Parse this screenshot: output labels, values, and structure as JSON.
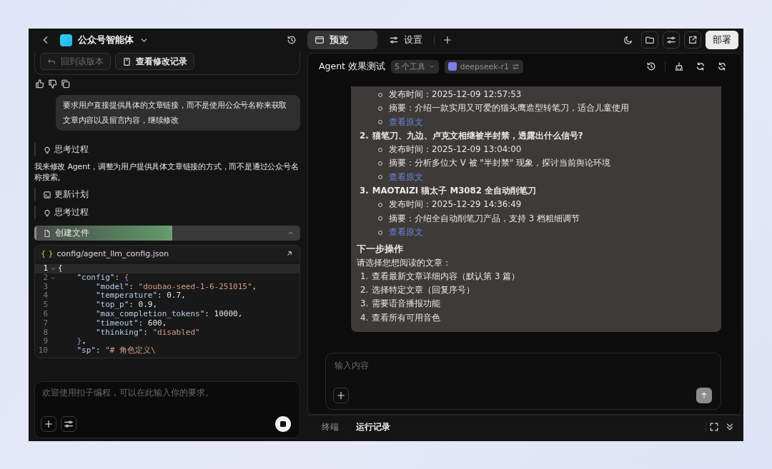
{
  "app_bar": {
    "title": "公众号智能体"
  },
  "tabs": [
    {
      "label": "预览",
      "selected": true
    },
    {
      "label": "设置",
      "selected": false
    }
  ],
  "deploy_button": "部署",
  "chat": {
    "version_buttons": [
      {
        "label": "回到该版本",
        "disabled": true
      },
      {
        "label": "查看修改记录",
        "disabled": false
      }
    ],
    "user_message": "要求用户直接提供具体的文章链接，而不是使用公众号名称来获取文章内容以及留言内容，继续修改",
    "steps": [
      {
        "kind": "thinking",
        "label": "思考过程"
      },
      {
        "kind": "text",
        "text": "我来修改 Agent，调整为用户提供具体文章链接的方式，而不是通过公众号名称搜索。"
      },
      {
        "kind": "plan",
        "label": "更新计划"
      },
      {
        "kind": "thinking",
        "label": "思考过程"
      },
      {
        "kind": "file",
        "label": "创建文件",
        "level": 0.52,
        "expanded": true
      }
    ],
    "file": {
      "glyph": "{ }",
      "path": "config/agent_llm_config.json",
      "lines": [
        {
          "number": "1",
          "foldable": true,
          "current": true,
          "tokens": [
            {
              "text": "{",
              "kind": "punct"
            }
          ]
        },
        {
          "number": "2",
          "foldable": true,
          "current": false,
          "tokens": [
            {
              "text": "    \"config\"",
              "kind": "key"
            },
            {
              "text": ": ",
              "kind": "punct"
            },
            {
              "text": "{",
              "kind": "brace"
            }
          ]
        },
        {
          "number": "3",
          "foldable": false,
          "current": false,
          "tokens": [
            {
              "text": "        \"model\"",
              "kind": "key"
            },
            {
              "text": ": ",
              "kind": "punct"
            },
            {
              "text": "\"doubao-seed-1-6-251015\"",
              "kind": "string"
            },
            {
              "text": ",",
              "kind": "punct"
            }
          ]
        },
        {
          "number": "4",
          "foldable": false,
          "current": false,
          "tokens": [
            {
              "text": "        \"temperature\"",
              "kind": "key"
            },
            {
              "text": ": 0.7,",
              "kind": "punct"
            }
          ]
        },
        {
          "number": "5",
          "foldable": false,
          "current": false,
          "tokens": [
            {
              "text": "        \"top_p\"",
              "kind": "key"
            },
            {
              "text": ": 0.9,",
              "kind": "punct"
            }
          ]
        },
        {
          "number": "6",
          "foldable": false,
          "current": false,
          "tokens": [
            {
              "text": "        \"max_completion_tokens\"",
              "kind": "key"
            },
            {
              "text": ": 10000,",
              "kind": "punct"
            }
          ]
        },
        {
          "number": "7",
          "foldable": false,
          "current": false,
          "tokens": [
            {
              "text": "        \"timeout\"",
              "kind": "key"
            },
            {
              "text": ": 600,",
              "kind": "punct"
            }
          ]
        },
        {
          "number": "8",
          "foldable": false,
          "current": false,
          "tokens": [
            {
              "text": "        \"thinking\"",
              "kind": "key"
            },
            {
              "text": ": ",
              "kind": "punct"
            },
            {
              "text": "\"disabled\"",
              "kind": "string"
            }
          ]
        },
        {
          "number": "9",
          "foldable": false,
          "current": false,
          "tokens": [
            {
              "text": "    }",
              "kind": "brace"
            },
            {
              "text": ",",
              "kind": "punct"
            }
          ]
        },
        {
          "number": "10",
          "foldable": false,
          "current": false,
          "tokens": [
            {
              "text": "    \"sp\"",
              "kind": "key"
            },
            {
              "text": ": ",
              "kind": "punct"
            },
            {
              "text": "\"# 角色定义\\",
              "kind": "string"
            }
          ]
        }
      ]
    },
    "placeholder": "欢迎使用扣子编程，可以在此输入你的要求。"
  },
  "preview": {
    "title": "Agent 效果测试",
    "tools_chip": "5 个工具",
    "model_chip": "deepseek-r1",
    "articles": [
      {
        "details": [
          {
            "kind": "text",
            "text": "发布时间：2025-12-09 12:57:53"
          },
          {
            "kind": "text",
            "text": "摘要：介绍一款实用又可爱的猫头鹰造型转笔刀，适合儿童使用"
          },
          {
            "kind": "link",
            "text": "查看原文"
          }
        ]
      },
      {
        "number": "2.",
        "title": "猫笔刀、九边、卢克文相继被半封禁，透露出什么信号?",
        "details": [
          {
            "kind": "text",
            "text": "发布时间：2025-12-09 13:04:00"
          },
          {
            "kind": "text",
            "text": "摘要：分析多位大 V 被 \"半封禁\" 现象，探讨当前舆论环境"
          },
          {
            "kind": "link",
            "text": "查看原文"
          }
        ]
      },
      {
        "number": "3.",
        "title": "MAOTAIZI 猫太子 M3082 全自动削笔刀",
        "details": [
          {
            "kind": "text",
            "text": "发布时间：2025-12-29 14:36:49"
          },
          {
            "kind": "text",
            "text": "摘要：介绍全自动削笔刀产品，支持 3 档粗细调节"
          },
          {
            "kind": "link",
            "text": "查看原文"
          }
        ]
      }
    ],
    "next_heading": "下一步操作",
    "next_prompt": "请选择您想阅读的文章：",
    "options": [
      {
        "number": "1.",
        "text": "查看最新文章详细内容（默认第 3 篇）"
      },
      {
        "number": "2.",
        "text": "选择特定文章（回复序号）"
      },
      {
        "number": "3.",
        "text": "需要语音播报功能"
      },
      {
        "number": "4.",
        "text": "查看所有可用音色"
      }
    ],
    "input_placeholder": "输入内容",
    "send_disabled": true
  },
  "bottom_tabs": [
    {
      "label": "终端",
      "selected": false
    },
    {
      "label": "运行记录",
      "selected": true
    }
  ]
}
